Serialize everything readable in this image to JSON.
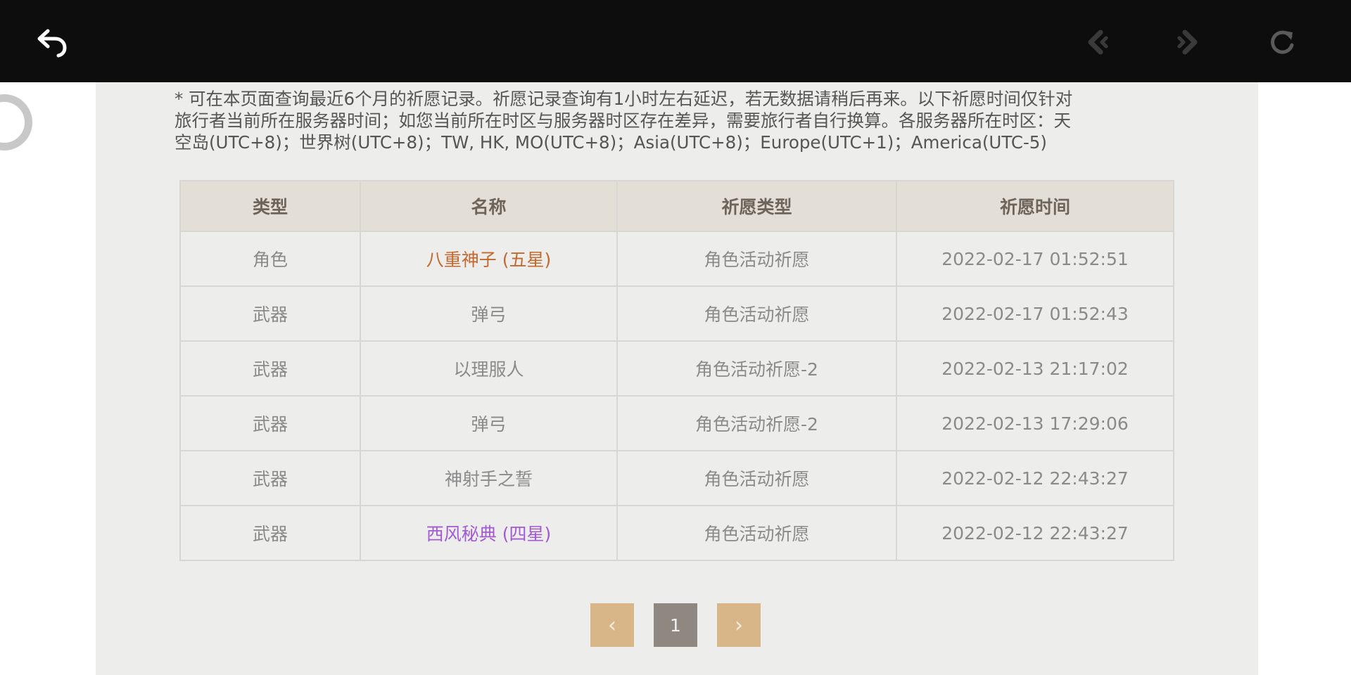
{
  "toolbar": {
    "back_icon": "back-arrow-icon",
    "prev_icon": "chevron-left-icon",
    "next_icon": "chevron-right-icon",
    "reload_icon": "reload-icon"
  },
  "notice": {
    "line1": "* 可在本页面查询最近6个月的祈愿记录。祈愿记录查询有1小时左右延迟，若无数据请稍后再来。以下祈愿时间仅针对",
    "line2": "旅行者当前所在服务器时间；如您当前所在时区与服务器时区存在差异，需要旅行者自行换算。各服务器所在时区：天",
    "line3": "空岛(UTC+8)；世界树(UTC+8)；TW, HK, MO(UTC+8)；Asia(UTC+8)；Europe(UTC+1)；America(UTC-5)"
  },
  "table": {
    "headers": [
      "类型",
      "名称",
      "祈愿类型",
      "祈愿时间"
    ],
    "rows": [
      {
        "type": "角色",
        "name": "八重神子 (五星)",
        "wish_type": "角色活动祈愿",
        "time": "2022-02-17 01:52:51"
      },
      {
        "type": "武器",
        "name": "弹弓",
        "wish_type": "角色活动祈愿",
        "time": "2022-02-17 01:52:43"
      },
      {
        "type": "武器",
        "name": "以理服人",
        "wish_type": "角色活动祈愿-2",
        "time": "2022-02-13 21:17:02"
      },
      {
        "type": "武器",
        "name": "弹弓",
        "wish_type": "角色活动祈愿-2",
        "time": "2022-02-13 17:29:06"
      },
      {
        "type": "武器",
        "name": "神射手之誓",
        "wish_type": "角色活动祈愿",
        "time": "2022-02-12 22:43:27"
      },
      {
        "type": "武器",
        "name": "西风秘典 (四星)",
        "wish_type": "角色活动祈愿",
        "time": "2022-02-12 22:43:27"
      }
    ]
  },
  "pagination": {
    "prev": "‹",
    "current": "1",
    "next": "›"
  },
  "colors": {
    "five_star": "#c4692e",
    "four_star": "#a25ad3",
    "pager_button": "#d9b688",
    "pager_current": "#8f8880"
  }
}
